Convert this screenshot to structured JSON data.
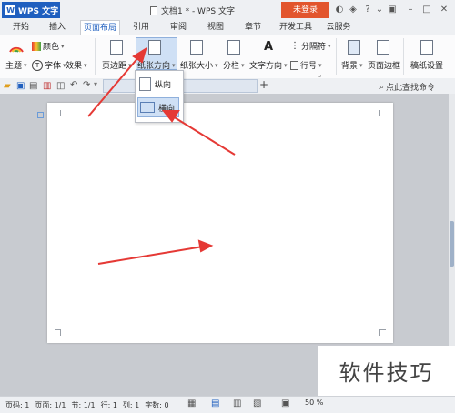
{
  "app": {
    "wps_label": "WPS 文字",
    "doc_title": "文档1 * - WPS 文字",
    "login": "未登录",
    "help": "?"
  },
  "tabs": [
    "开始",
    "插入",
    "页面布局",
    "引用",
    "审阅",
    "视图",
    "章节",
    "开发工具",
    "云服务"
  ],
  "ribbon": {
    "theme": "主题",
    "color": "颜色",
    "font": "字体",
    "effect": "效果",
    "margins": "页边距",
    "orientation": "纸张方向",
    "size": "纸张大小",
    "columns": "分栏",
    "text_direction": "文字方向",
    "line_numbers": "行号",
    "breaks": "分隔符",
    "background": "背景",
    "page_border": "页面边框",
    "manuscript": "稿纸设置"
  },
  "quickbar": {
    "search": "点此查找命令"
  },
  "orientation_menu": {
    "portrait": "纵向",
    "landscape": "横向"
  },
  "statusbar": {
    "page_num": "页码: 1",
    "pages": "页面: 1/1",
    "section": "节: 1/1",
    "row": "行: 1",
    "col": "列: 1",
    "chars": "字数: 0",
    "zoom": "50 %"
  },
  "watermark": "软件技巧",
  "colors": {
    "accent": "#1f5fbf",
    "login": "#e2552d",
    "arrow": "#e53935"
  }
}
